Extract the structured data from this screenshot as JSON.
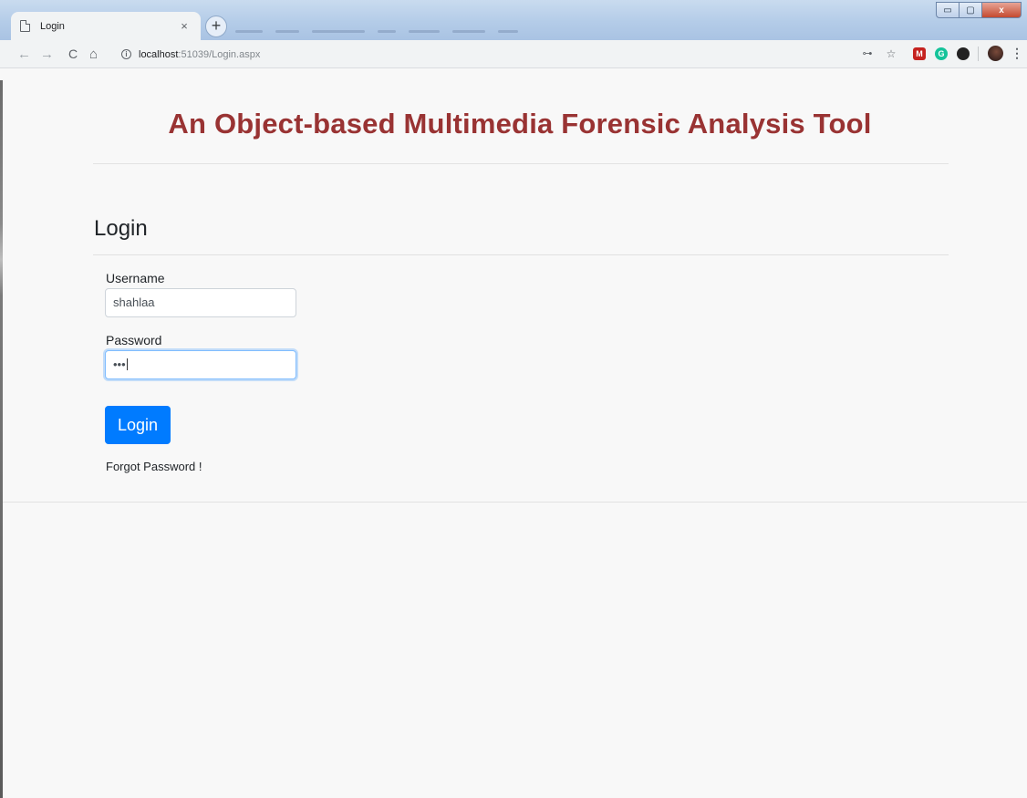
{
  "browser": {
    "tab_title": "Login",
    "tab_close": "×",
    "new_tab": "+",
    "url_host": "localhost",
    "url_path": ":51039/Login.aspx",
    "window_controls": {
      "minimize": "▭",
      "maximize": "▢",
      "close": "x"
    },
    "nav": {
      "back": "←",
      "forward": "→",
      "reload": "C",
      "home": "⌂"
    },
    "info": "i",
    "icons": [
      "key-icon",
      "star-icon",
      "extension-m-icon",
      "grammarly-icon",
      "extension-dark-icon",
      "profile-avatar",
      "more-menu-icon"
    ],
    "star": "☆",
    "key": "⊶",
    "ext_m": "M",
    "ext_g": "G",
    "menu": "⋮"
  },
  "page": {
    "title": "An Object-based Multimedia Forensic Analysis Tool",
    "login_heading": "Login",
    "username_label": "Username",
    "username_value": "shahlaa",
    "password_label": "Password",
    "password_value": "•••",
    "login_button": "Login",
    "forgot_link": "Forgot Password !"
  },
  "colors": {
    "title": "#993333",
    "primary_button": "#007bff",
    "page_background": "#f8f8f8"
  }
}
